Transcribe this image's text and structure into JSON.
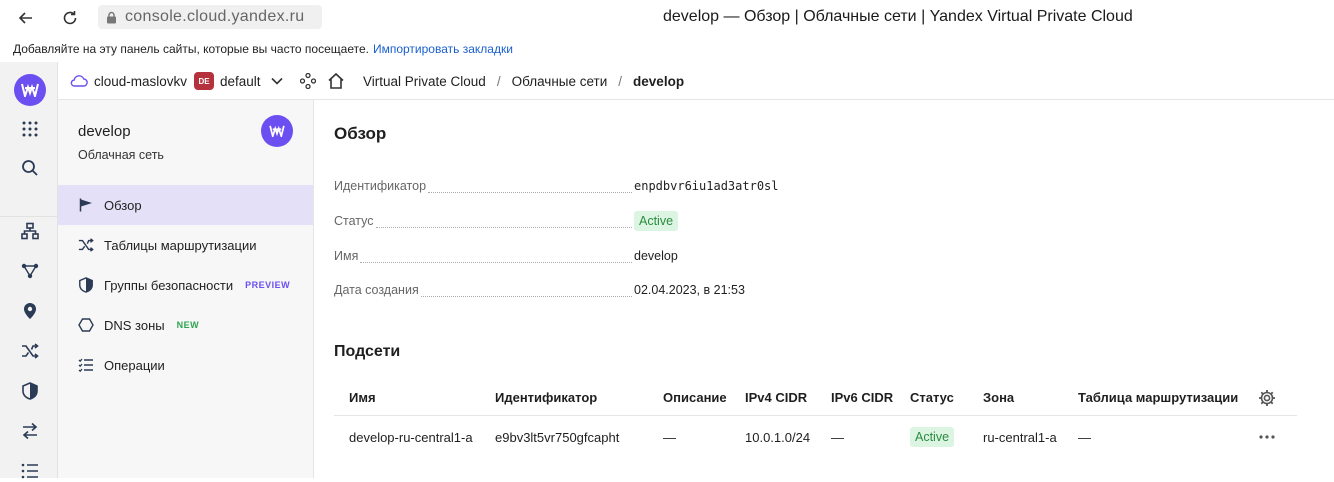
{
  "browser": {
    "url": "console.cloud.yandex.ru",
    "window_title": "develop — Обзор | Облачные сети | Yandex Virtual Private Cloud"
  },
  "bookmarks": {
    "text": "Добавляйте на эту панель сайты, которые вы часто посещаете.",
    "link": "Импортировать закладки"
  },
  "header": {
    "cloud": "cloud-maslovkv",
    "folder_badge": "DE",
    "folder": "default",
    "crumbs": [
      "Virtual Private Cloud",
      "Облачные сети",
      "develop"
    ],
    "separator": "/"
  },
  "sidebar": {
    "title": "develop",
    "subtitle": "Облачная сеть",
    "items": [
      {
        "label": "Обзор",
        "icon": "flag-icon"
      },
      {
        "label": "Таблицы маршрутизации",
        "icon": "shuffle-icon"
      },
      {
        "label": "Группы безопасности",
        "icon": "shield-icon",
        "badge": "PREVIEW"
      },
      {
        "label": "DNS зоны",
        "icon": "hexagon-icon",
        "badge": "NEW"
      },
      {
        "label": "Операции",
        "icon": "list-icon"
      }
    ]
  },
  "overview": {
    "title": "Обзор",
    "rows": [
      {
        "key": "Идентификатор",
        "value": "enpdbvr6iu1ad3atr0sl"
      },
      {
        "key": "Статус",
        "value": "Active"
      },
      {
        "key": "Имя",
        "value": "develop"
      },
      {
        "key": "Дата создания",
        "value": "02.04.2023, в 21:53"
      }
    ]
  },
  "subnets": {
    "title": "Подсети",
    "columns": [
      "Имя",
      "Идентификатор",
      "Описание",
      "IPv4 CIDR",
      "IPv6 CIDR",
      "Статус",
      "Зона",
      "Таблица маршрутизации"
    ],
    "rows": [
      {
        "name": "develop-ru-central1-a",
        "id": "e9bv3lt5vr750gfcapht",
        "description": "—",
        "ipv4": "10.0.1.0/24",
        "ipv6": "—",
        "status": "Active",
        "zone": "ru-central1-a",
        "route_table": "—"
      }
    ]
  },
  "colors": {
    "accent": "#6b4ff0",
    "active_bg": "#dcf5e2",
    "active_text": "#2b8a3e",
    "folder_badge": "#b5313b"
  }
}
